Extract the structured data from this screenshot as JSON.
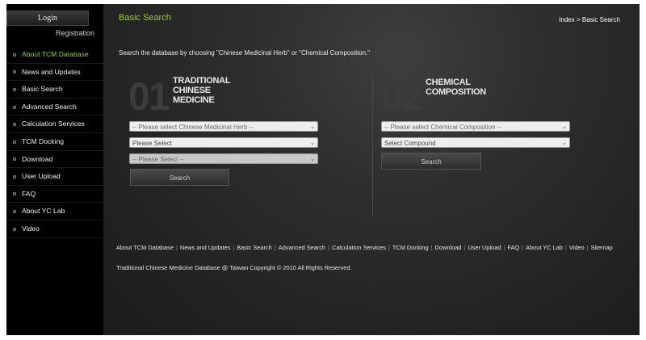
{
  "sidebar": {
    "login": "Login",
    "registration": "Registration",
    "items": [
      {
        "label": "About TCM Database"
      },
      {
        "label": "News and Updates"
      },
      {
        "label": "Basic Search"
      },
      {
        "label": "Advanced Search"
      },
      {
        "label": "Calculation Services"
      },
      {
        "label": "TCM Docking"
      },
      {
        "label": "Download"
      },
      {
        "label": "User Upload"
      },
      {
        "label": "FAQ"
      },
      {
        "label": "About YC Lab"
      },
      {
        "label": "Video"
      }
    ]
  },
  "header": {
    "title": "Basic Search",
    "breadcrumb": "Index > Basic Search"
  },
  "intro": "Search the database by choosing \"Chinese Medicinal Herb\" or \"Chemical Composition.\"",
  "panels": {
    "tcm": {
      "number": "01",
      "title_line1": "TRADITIONAL",
      "title_line2": "CHINESE",
      "title_line3": "MEDICINE",
      "select_herb": "-- Please select Chinese Medicinal Herb --",
      "select_two": "Please Select",
      "select_three": "-- Please Select --",
      "search": "Search"
    },
    "chemical": {
      "number": "02",
      "title_line1": "CHEMICAL",
      "title_line2": "COMPOSITION",
      "select_composition": "-- Please select Chemical Composition --",
      "select_compound": "Select Compound",
      "search": "Search"
    }
  },
  "footer": {
    "links": [
      "About TCM Database",
      "News and Updates",
      "Basic Search",
      "Advanced Search",
      "Calculation Services",
      "TCM Docking",
      "Download",
      "User Upload",
      "FAQ",
      "About YC Lab",
      "Video",
      "Sitemap"
    ],
    "copyright": "Traditional Chinese Medicine Database @ Taiwan Copyright © 2010 All Rights Reserved."
  },
  "icons": {
    "nav_bullet": "circle-bullet-icon",
    "select_arrow": "chevron-down-icon"
  },
  "colors": {
    "accent": "#9acd32",
    "background": "#000000"
  }
}
